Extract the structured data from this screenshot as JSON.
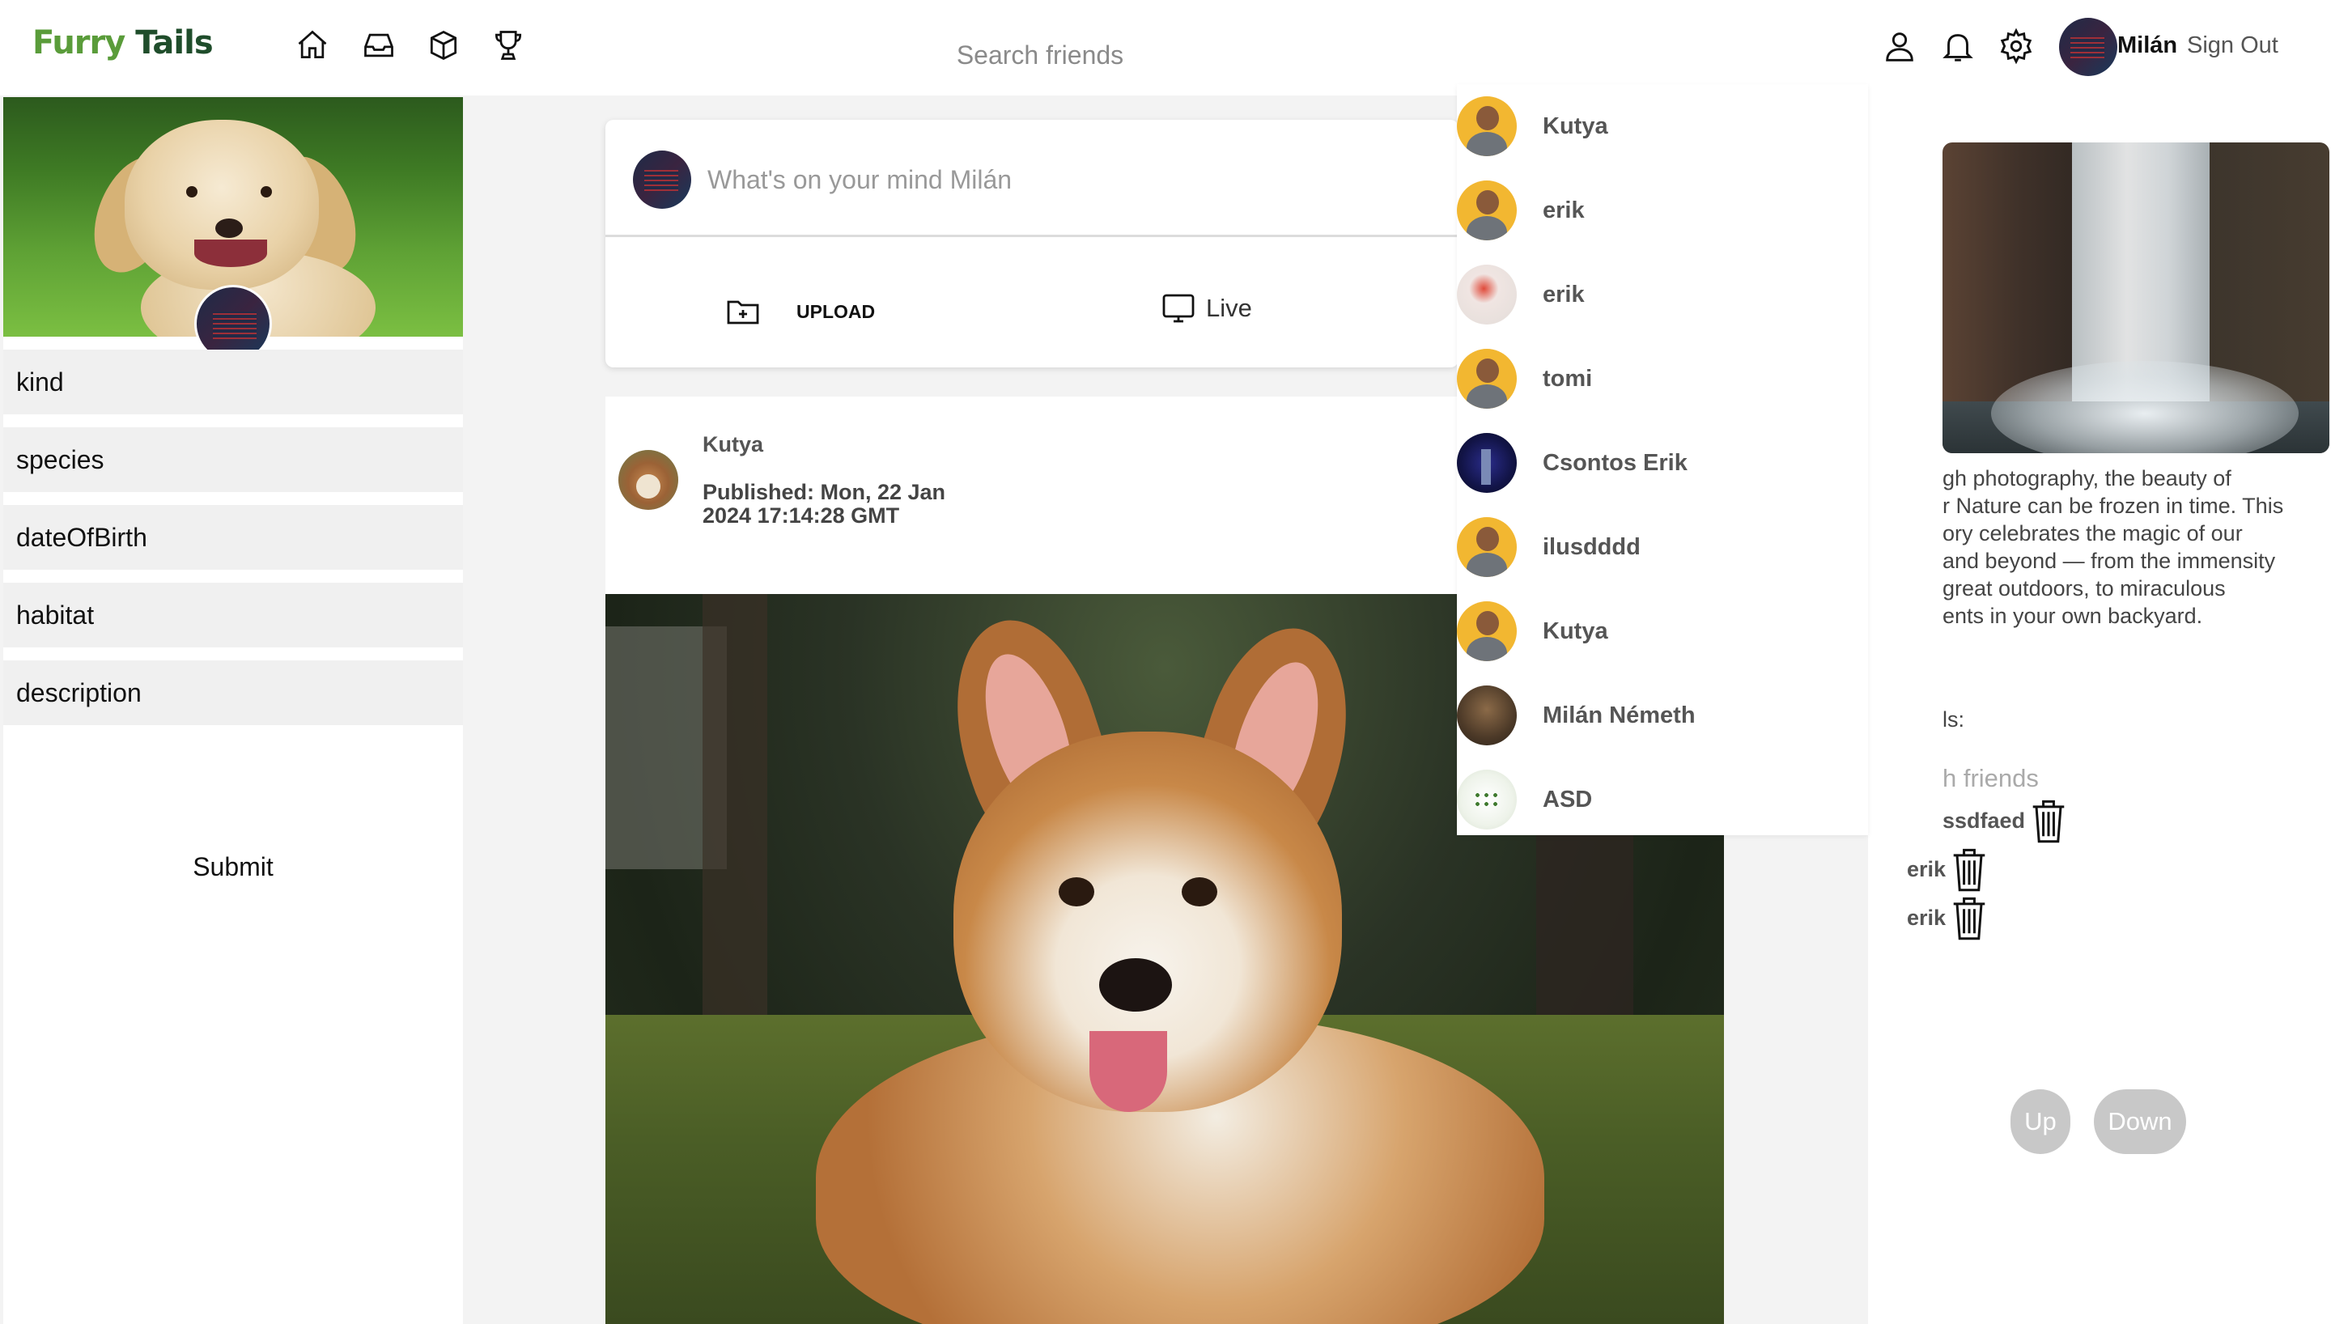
{
  "header": {
    "logo_part1": "Furry",
    "logo_part2": " Tails",
    "nav_icons": [
      "home-icon",
      "inbox-icon",
      "box-icon",
      "trophy-icon"
    ],
    "search_placeholder": "Search friends",
    "right_icons": [
      "user-icon",
      "bell-icon",
      "gear-icon"
    ],
    "user_name": "Milán",
    "sign_out_label": "Sign Out"
  },
  "profile_form": {
    "fields": [
      {
        "placeholder": "kind"
      },
      {
        "placeholder": "species"
      },
      {
        "placeholder": "dateOfBirth"
      },
      {
        "placeholder": "habitat"
      },
      {
        "placeholder": "description"
      }
    ],
    "submit_label": "Submit"
  },
  "composer": {
    "placeholder": "What's on your mind Milán",
    "upload_label": "UPLOAD",
    "live_label": "Live"
  },
  "post": {
    "author": "Kutya",
    "published": "Published: Mon, 22 Jan 2024 17:14:28 GMT"
  },
  "friend_dropdown": [
    {
      "name": "Kutya",
      "avatar": "default"
    },
    {
      "name": "erik",
      "avatar": "default"
    },
    {
      "name": "erik",
      "avatar": "cocktail"
    },
    {
      "name": "tomi",
      "avatar": "default"
    },
    {
      "name": "Csontos Erik",
      "avatar": "night"
    },
    {
      "name": "ilusdddd",
      "avatar": "default"
    },
    {
      "name": "Kutya",
      "avatar": "default"
    },
    {
      "name": "Milán Németh",
      "avatar": "photo"
    },
    {
      "name": "ASD",
      "avatar": "asd"
    }
  ],
  "right_panel": {
    "description": "gh photography, the beauty of\nr Nature can be frozen in time. This\nory celebrates the magic of our\n and beyond — from the immensity\n great outdoors, to miraculous\nents in your own backyard.",
    "friends_label": "ls:",
    "friends_search_placeholder": "h friends",
    "friends": [
      "ssdfaed",
      "erik",
      "erik"
    ],
    "up_label": "Up",
    "down_label": "Down"
  },
  "colors": {
    "logo_dark": "#1f4d2b",
    "logo_light": "#5a9c3a",
    "pill_bg": "#c8c8c8",
    "page_bg": "#f3f3f3"
  }
}
